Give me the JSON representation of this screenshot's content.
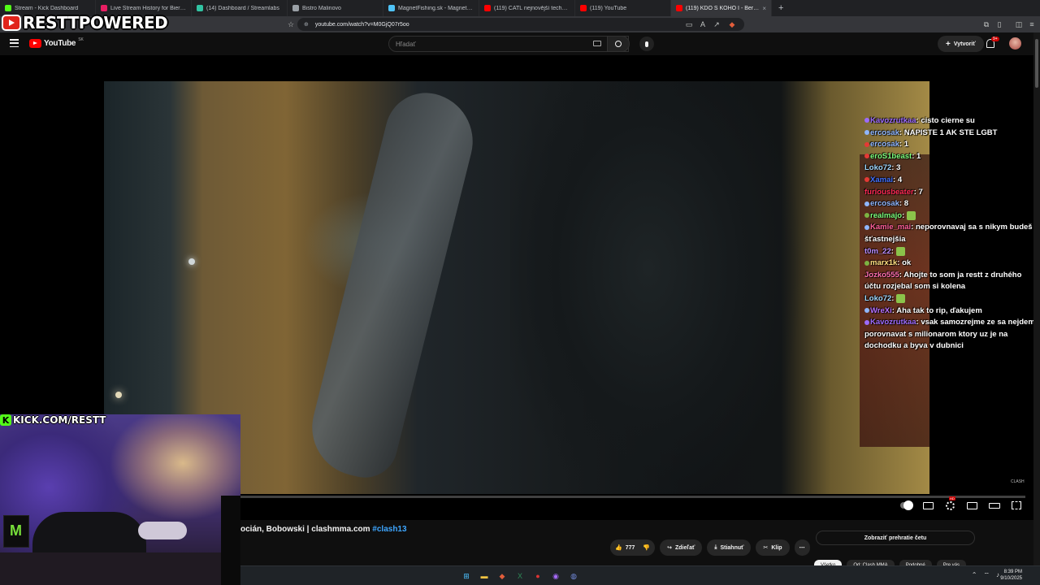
{
  "browser": {
    "tabs": [
      {
        "label": "Stream - Kick Dashboard",
        "color": "#53fc18"
      },
      {
        "label": "Live Stream History for Bierp Shares",
        "color": "#e91e63"
      },
      {
        "label": "(14) Dashboard / Streamlabs",
        "color": "#31c3a2"
      },
      {
        "label": "Bistro Malinovo",
        "color": "#9aa0a6"
      },
      {
        "label": "MagnetFishing.sk - Magnety a laná",
        "color": "#4fc3f7"
      },
      {
        "label": "(119) CATL nejnovější technologie h",
        "color": "#ff0000"
      },
      {
        "label": "(119) YouTube",
        "color": "#ff0000"
      },
      {
        "label": "(119) KDO S KOHO I - Beránek, ",
        "color": "#ff0000"
      }
    ],
    "active_tab_index": 7,
    "new_tab_label": "+",
    "url": "youtube.com/watch?v=M0GjQ07r5oo"
  },
  "overlay": {
    "brand_text": "RESTTPOWERED",
    "kick_text": "KICK.COM/RESTT",
    "kick_letter": "K"
  },
  "header": {
    "logo_word": "YouTube",
    "logo_country": "SK",
    "search_placeholder": "Hľadať",
    "create_label": "Vytvoriť",
    "notifications_badge": "9+"
  },
  "chat": [
    {
      "user": "Kavozrutkaa",
      "color": "#9c6bff",
      "badge": "#9c6bff",
      "text": "cisto cierne su"
    },
    {
      "user": "ercosak",
      "color": "#8fb6ff",
      "badge": "#8fb6ff",
      "text": "NAPISTE 1 AK STE LGBT"
    },
    {
      "user": "ercosak",
      "color": "#8fb6ff",
      "badge": "#e53935",
      "text": "1"
    },
    {
      "user": "eroS1beast",
      "color": "#7cff7c",
      "badge": "#e53935",
      "text": "1"
    },
    {
      "user": "Loko72",
      "color": "#9fd8ff",
      "badge": "",
      "text": "3"
    },
    {
      "user": "Xamai",
      "color": "#3f6fff",
      "badge": "#e53935",
      "text": "4"
    },
    {
      "user": "furiousbeater",
      "color": "#ff2a55",
      "badge": "",
      "text": "7"
    },
    {
      "user": "ercosak",
      "color": "#8fb6ff",
      "badge": "#8fb6ff",
      "text": "8"
    },
    {
      "user": "realmajo",
      "color": "#7cff7c",
      "badge": "#7cb342",
      "text": ""
    },
    {
      "user": "Kamie_mai",
      "color": "#ff5f9a",
      "badge": "#8fb6ff",
      "text": "neporovnavaj sa s nikym budeš šťastnejšia"
    },
    {
      "user": "t0m_22",
      "color": "#b98cff",
      "badge": "",
      "text": ""
    },
    {
      "user": "marx1k",
      "color": "#ffe082",
      "badge": "#7cb342",
      "text": "ok"
    },
    {
      "user": "Jozko555",
      "color": "#ff6fb0",
      "badge": "",
      "text": "Ahojte to som ja restt z druhého účtu rozjebal som si kolena"
    },
    {
      "user": "Loko72",
      "color": "#9fd8ff",
      "badge": "",
      "text": ""
    },
    {
      "user": "WreXi",
      "color": "#b470ff",
      "badge": "#8fb6ff",
      "text": "Aha tak to rip, ďakujem"
    },
    {
      "user": "Kavozrutkaa",
      "color": "#9c6bff",
      "badge": "#9c6bff",
      "text": "vsak samozrejme ze sa nejdem porovnavat s milionarom ktory uz je na dochodku a byva v dubnici"
    }
  ],
  "video": {
    "title_visible": "ocián, Bobowski | clashmma.com ",
    "hashtag": "#clash13",
    "watermark": "CLASH",
    "progress_fraction": 0.0
  },
  "actions": {
    "likes": "777",
    "share_label": "Zdieľať",
    "download_label": "Stiahnuť",
    "clip_label": "Klip",
    "more_label": "⋯"
  },
  "sidebar": {
    "replay_chat_label": "Zobraziť prehratie četu",
    "chips": [
      "Všetko",
      "Od: Clash MMA",
      "Podobné",
      "Pre vás"
    ]
  },
  "taskbar": {
    "clock_time": "8:39 PM",
    "clock_date": "9/10/2025"
  }
}
